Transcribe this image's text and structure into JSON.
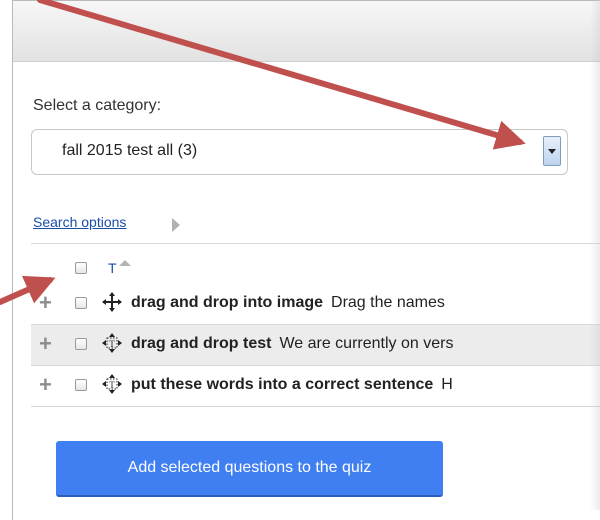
{
  "category": {
    "label": "Select a category:",
    "selected": "fall 2015 test all (3)"
  },
  "search_options": "Search options",
  "table": {
    "type_column_header": "T",
    "rows": [
      {
        "name": "drag and drop into image",
        "description": "Drag the names",
        "icon": "move-cross-icon"
      },
      {
        "name": "drag and drop test",
        "description": "We are currently on vers",
        "icon": "drag-drop-text-icon"
      },
      {
        "name": "put these words into a correct sentence",
        "description": "H",
        "icon": "drag-drop-text-icon"
      }
    ]
  },
  "add_button": "Add selected questions to the quiz",
  "colors": {
    "annotation_arrow": "#c0504d",
    "primary_button": "#3f7ff2",
    "link": "#1a4ea8"
  }
}
